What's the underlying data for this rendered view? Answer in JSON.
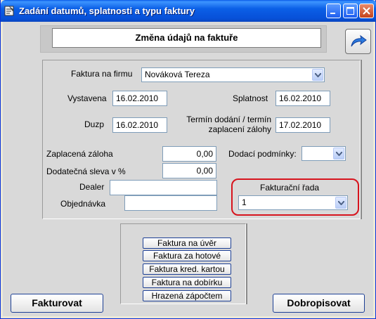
{
  "window": {
    "title": "Zadání datumů, splatnosti a typu faktury",
    "icon": "invoice-app-icon"
  },
  "header": {
    "text": "Změna údajů na faktuře",
    "refresh_icon": "blue-arrow-icon"
  },
  "form": {
    "company_label": "Faktura na firmu",
    "company_value": "Nováková Tereza",
    "issued_label": "Vystavena",
    "issued_value": "16.02.2010",
    "due_label": "Splatnost",
    "due_value": "16.02.2010",
    "duzp_label": "Duzp",
    "duzp_value": "16.02.2010",
    "delivery_term_label_line1": "Termín dodání / termín",
    "delivery_term_label_line2": "zaplacení zálohy",
    "delivery_term_value": "17.02.2010",
    "advance_label": "Zaplacená záloha",
    "advance_value": "0,00",
    "discount_label": "Dodatečná sleva v %",
    "discount_value": "0,00",
    "delivery_conditions_label": "Dodací podmínky:",
    "delivery_conditions_value": "",
    "dealer_label": "Dealer",
    "dealer_value": "",
    "order_label": "Objednávka",
    "order_value": "",
    "series_label": "Fakturační řada",
    "series_value": "1"
  },
  "invoice_type_buttons": [
    "Faktura na úvěr",
    "Faktura za hotové",
    "Faktura kred. kartou",
    "Faktura na dobírku",
    "Hrazená zápočtem"
  ],
  "footer": {
    "invoice_button": "Fakturovat",
    "credit_note_button": "Dobropisovat"
  },
  "colors": {
    "titlebar": "#0b5fe6",
    "highlight": "#d7141d",
    "background": "#d9d9d9"
  }
}
